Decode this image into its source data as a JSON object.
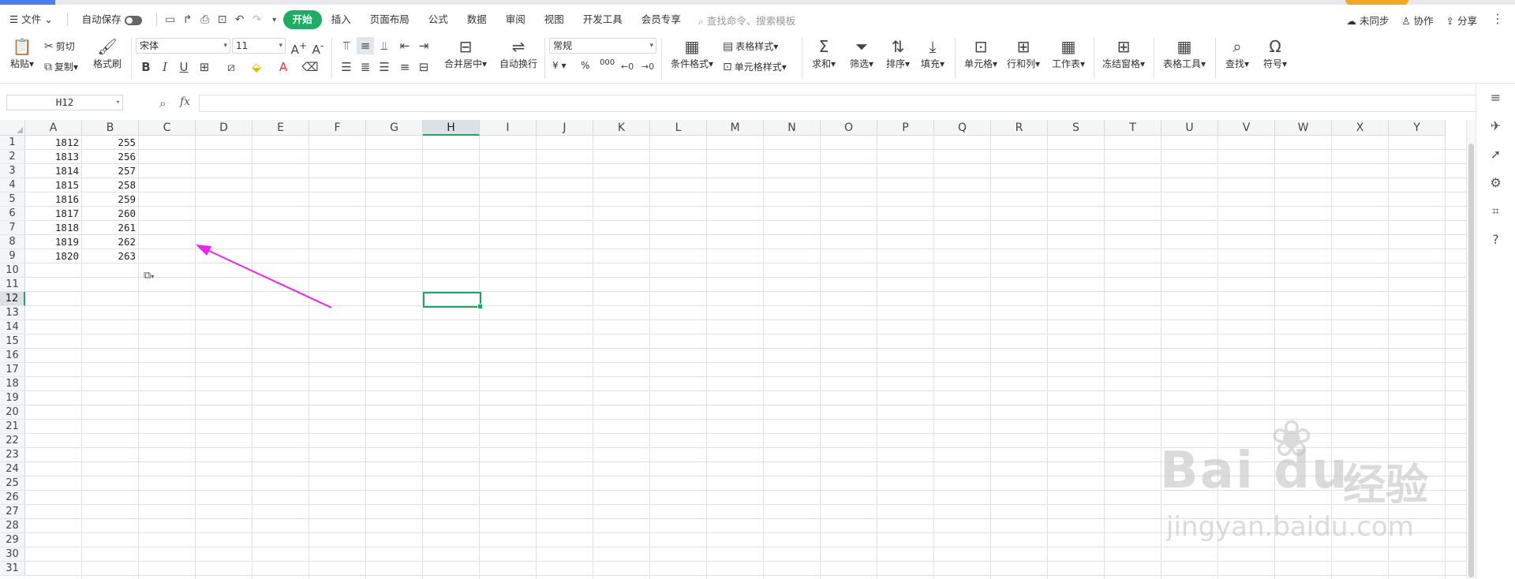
{
  "menu": {
    "file": "文件",
    "autosave": "自动保存",
    "tabs": [
      "开始",
      "插入",
      "页面布局",
      "公式",
      "数据",
      "审阅",
      "视图",
      "开发工具",
      "会员专享"
    ],
    "search_placeholder": "查找命令、搜索模板",
    "right": {
      "sync": "未同步",
      "collab": "协作",
      "share": "分享"
    }
  },
  "ribbon": {
    "paste": "粘贴",
    "cut": "剪切",
    "copy": "复制",
    "format_painter": "格式刷",
    "font_name": "宋体",
    "font_size": "11",
    "merge_center": "合并居中",
    "wrap_text": "自动换行",
    "number_format": "常规",
    "currency_symbol": "¥",
    "percent_symbol": "%",
    "thousands_symbol": "000",
    "conditional_format": "条件格式",
    "table_style": "表格样式",
    "cell_style": "单元格样式",
    "sum": "求和",
    "filter": "筛选",
    "sort": "排序",
    "fill": "填充",
    "cell": "单元格",
    "row_col": "行和列",
    "worksheet": "工作表",
    "freeze": "冻结窗格",
    "table_tools": "表格工具",
    "find": "查找",
    "symbol": "符号"
  },
  "formula_bar": {
    "name_box": "H12",
    "fx": "fx",
    "formula": ""
  },
  "columns": [
    "A",
    "B",
    "C",
    "D",
    "E",
    "F",
    "G",
    "H",
    "I",
    "J",
    "K",
    "L",
    "M",
    "N",
    "O",
    "P",
    "Q",
    "R",
    "S",
    "T",
    "U",
    "V",
    "W",
    "X",
    "Y"
  ],
  "selected_column": "H",
  "selected_row": 12,
  "rows": [
    1,
    2,
    3,
    4,
    5,
    6,
    7,
    8,
    9,
    10,
    11,
    12,
    13,
    14,
    15,
    16,
    17,
    18,
    19,
    20,
    21,
    22,
    23,
    24,
    25,
    26,
    27,
    28,
    29,
    30,
    31
  ],
  "cells": [
    {
      "a": "1812",
      "b": "255"
    },
    {
      "a": "1813",
      "b": "256"
    },
    {
      "a": "1814",
      "b": "257"
    },
    {
      "a": "1815",
      "b": "258"
    },
    {
      "a": "1816",
      "b": "259"
    },
    {
      "a": "1817",
      "b": "260"
    },
    {
      "a": "1818",
      "b": "261"
    },
    {
      "a": "1819",
      "b": "262"
    },
    {
      "a": "1820",
      "b": "263"
    }
  ],
  "colors": {
    "accent": "#1fad64",
    "selection": "#21a366",
    "arrow": "#ee22ee"
  },
  "watermark": {
    "brand": "Bai du",
    "cn": "经验",
    "url": "jingyan.baidu.com"
  }
}
